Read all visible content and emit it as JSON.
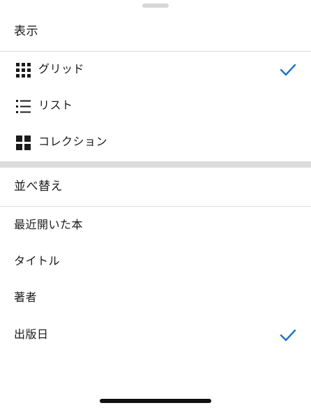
{
  "display_section": {
    "title": "表示",
    "items": [
      {
        "label": "グリッド",
        "icon": "grid-icon",
        "selected": true
      },
      {
        "label": "リスト",
        "icon": "list-icon",
        "selected": false
      },
      {
        "label": "コレクション",
        "icon": "collection-icon",
        "selected": false
      }
    ]
  },
  "sort_section": {
    "title": "並べ替え",
    "items": [
      {
        "label": "最近開いた本",
        "selected": false
      },
      {
        "label": "タイトル",
        "selected": false
      },
      {
        "label": "著者",
        "selected": false
      },
      {
        "label": "出版日",
        "selected": true
      }
    ]
  },
  "colors": {
    "accent": "#1a73c9",
    "icon": "#1a1a1a",
    "divider": "#dcdcdc"
  }
}
